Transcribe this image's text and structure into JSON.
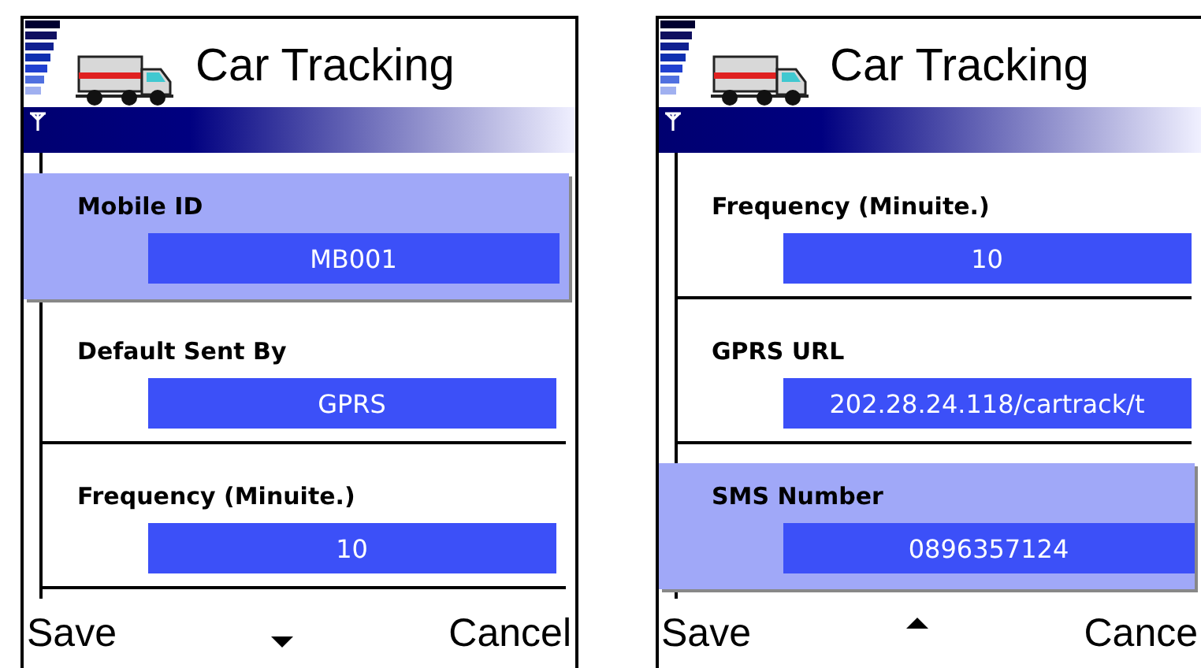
{
  "screens": [
    {
      "title": "Car Tracking",
      "can_scroll_up": false,
      "softkeys": {
        "left": "Save",
        "right": "Cancel"
      },
      "fields": [
        {
          "label": "Mobile ID",
          "value": "MB001",
          "selected": true
        },
        {
          "label": "Default Sent By",
          "value": "GPRS",
          "selected": false
        },
        {
          "label": "Frequency (Minuite.)",
          "value": "10",
          "selected": false
        }
      ]
    },
    {
      "title": "Car Tracking",
      "can_scroll_up": true,
      "softkeys": {
        "left": "Save",
        "right": "Cance"
      },
      "fields": [
        {
          "label": "Frequency (Minuite.)",
          "value": "10",
          "selected": false
        },
        {
          "label": "GPRS URL",
          "value": "202.28.24.118/cartrack/t",
          "selected": false
        },
        {
          "label": "SMS Number",
          "value": "0896357124",
          "selected": true
        }
      ]
    }
  ]
}
